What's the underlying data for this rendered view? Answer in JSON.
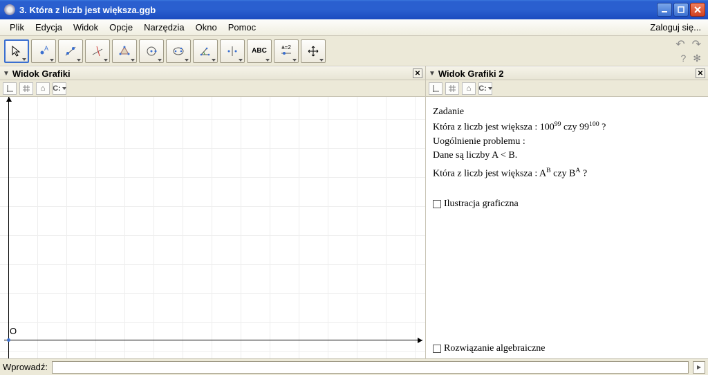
{
  "window": {
    "title": "3. Która z liczb jest większa.ggb"
  },
  "menu": {
    "items": [
      "Plik",
      "Edycja",
      "Widok",
      "Opcje",
      "Narzędzia",
      "Okno",
      "Pomoc"
    ],
    "login": "Zaloguj się..."
  },
  "toolbar": {
    "tools": [
      "move",
      "point",
      "line",
      "perpendicular",
      "polygon",
      "circle",
      "conic",
      "angle",
      "reflect",
      "text",
      "slider",
      "move-view"
    ],
    "text_label": "ABC",
    "slider_label": "a=2",
    "undo": "↶",
    "redo": "↷",
    "help": "?",
    "settings": "✻"
  },
  "panels": {
    "left": {
      "title": "Widok Grafiki",
      "origin": "O"
    },
    "right": {
      "title": "Widok Grafiki 2",
      "text": {
        "l1": "Zadanie",
        "l2a": "Która z liczb jest większa : 100",
        "l2b": "99",
        "l2c": " czy 99",
        "l2d": "100",
        "l2e": " ?",
        "l3": "Uogólnienie problemu :",
        "l4": "Dane są liczby A < B.",
        "l5a": "Która z liczb jest większa : A",
        "l5b": "B",
        "l5c": " czy B",
        "l5d": "A",
        "l5e": " ?",
        "cb1": "Ilustracja graficzna",
        "cb2": "Rozwiązanie algebraiczne"
      }
    }
  },
  "inputbar": {
    "label": "Wprowadź:",
    "value": "",
    "help": "⯈"
  }
}
